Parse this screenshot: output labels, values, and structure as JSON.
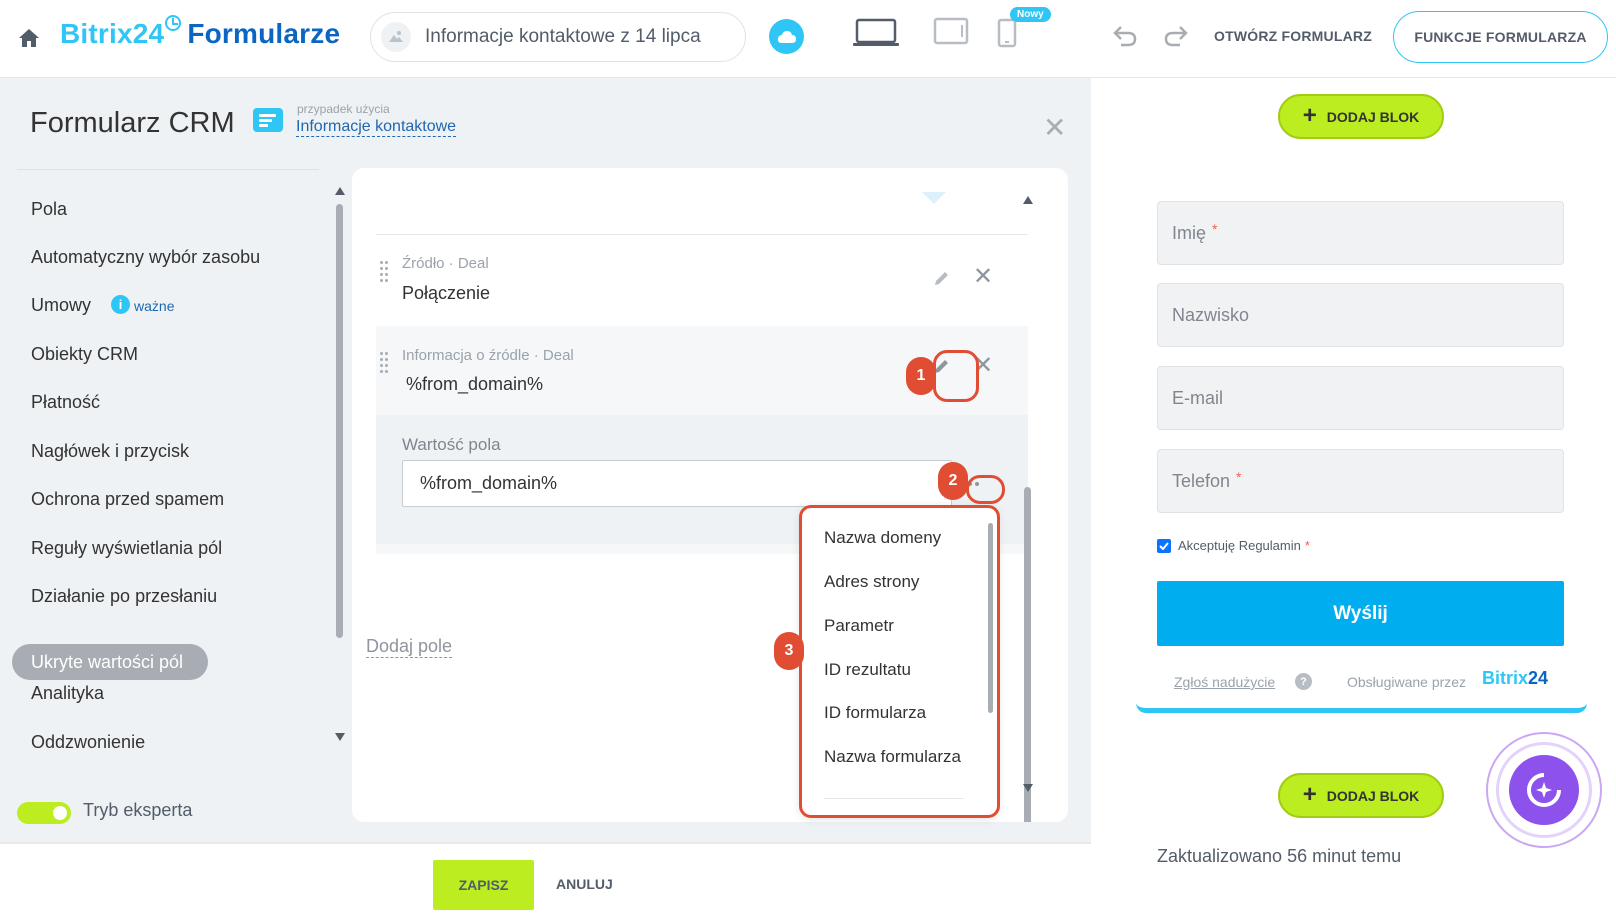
{
  "header": {
    "logo_brand": "Bitrix24",
    "logo_product": "Formularze",
    "form_name": "Informacje kontaktowe z 14 lipca",
    "new_badge": "Nowy",
    "open_form_label": "OTWÓRZ FORMULARZ",
    "features_label": "FUNKCJE FORMULARZA"
  },
  "panel": {
    "title": "Formularz CRM",
    "usecase_label": "przypadek użycia",
    "usecase_link": "Informacje kontaktowe"
  },
  "nav": {
    "items": [
      "Pola",
      "Automatyczny wybór zasobu",
      "Umowy",
      "Obiekty CRM",
      "Płatność",
      "Nagłówek i przycisk",
      "Ochrona przed spamem",
      "Reguły wyświetlania pól",
      "Działanie po przesłaniu",
      "Ukryte wartości pól",
      "Analityka",
      "Oddzwonienie"
    ],
    "active": "Ukryte wartości pól",
    "important_info": "i",
    "important_label": "ważne",
    "expert_mode": "Tryb eksperta",
    "expert_mode_on": true
  },
  "editor": {
    "field1": {
      "label": "Źródło · Deal",
      "value": "Połączenie"
    },
    "field2": {
      "label": "Informacja o źródle · Deal",
      "value": "%from_domain%"
    },
    "value_label": "Wartość pola",
    "value_input": "%from_domain%",
    "add_field": "Dodaj pole"
  },
  "dropdown": {
    "items": [
      "Nazwa domeny",
      "Adres strony",
      "Parametr",
      "ID rezultatu",
      "ID formularza",
      "Nazwa formularza"
    ]
  },
  "markers": [
    "1",
    "2",
    "3"
  ],
  "footer": {
    "save": "ZAPISZ",
    "cancel": "ANULUJ"
  },
  "preview": {
    "add_block": "DODAJ BLOK",
    "fields": [
      {
        "label": "Imię",
        "required": true
      },
      {
        "label": "Nazwisko",
        "required": false
      },
      {
        "label": "E-mail",
        "required": false
      },
      {
        "label": "Telefon",
        "required": true
      }
    ],
    "required_mark": "*",
    "consent": "Akceptuję Regulamin",
    "consent_checked": true,
    "send": "Wyślij",
    "report_abuse": "Zgłoś nadużycie",
    "help": "?",
    "powered_by": "Obsługiwane przez",
    "brand_a": "Bitrix",
    "brand_b": "24",
    "updated": "Zaktualizowano 56 minut temu"
  },
  "colors": {
    "accent": "#2fc6f6",
    "brand_dark": "#0b66c3",
    "lime": "#bbed21",
    "annotation": "#e14d33",
    "send": "#00aeef"
  }
}
